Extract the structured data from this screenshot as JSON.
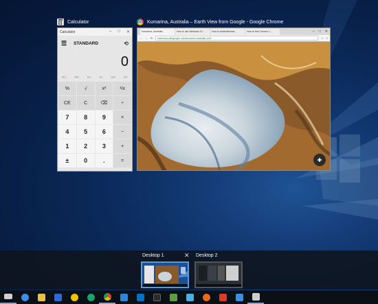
{
  "windows": [
    {
      "title": "Calculator"
    },
    {
      "title": "Kumarina, Australia – Earth View from Google - Google Chrome"
    }
  ],
  "calculator": {
    "titlebar": "Calculator",
    "mode": "STANDARD",
    "display": "0",
    "memory": [
      "MC",
      "MR",
      "M+",
      "M-",
      "MS",
      "M˅"
    ],
    "keys": [
      "%",
      "√",
      "x²",
      "¹/x",
      "CE",
      "C",
      "⌫",
      "÷",
      "7",
      "8",
      "9",
      "×",
      "4",
      "5",
      "6",
      "−",
      "1",
      "2",
      "3",
      "+",
      "±",
      "0",
      ".",
      "="
    ]
  },
  "browser": {
    "tabs": [
      "Kumarina, Australia - ",
      "How to use Windows 10 ...",
      "How to add/edit/creat...",
      "How to find Chrome 1..."
    ],
    "url": "earthview.withgoogle.com/kumarina-australia-1181"
  },
  "task_view": {
    "desktops": [
      {
        "label": "Desktop 1",
        "selected": true
      },
      {
        "label": "Desktop 2",
        "selected": false
      }
    ],
    "close_label": "✕"
  },
  "taskbar": {
    "icons": [
      "task-view-icon",
      "edge-icon",
      "file-explorer-icon",
      "store-icon",
      "weather-icon",
      "groove-icon",
      "chrome-icon",
      "photos-icon",
      "outlook-icon",
      "xbox-icon",
      "notepad-icon",
      "photos-app-icon",
      "firefox-icon",
      "office-icon",
      "mail-icon",
      "calculator-icon"
    ],
    "colors": [
      "#d0d0d0",
      "#3a8ee6",
      "#e8c04a",
      "#2b6ad6",
      "#f0c400",
      "#1aa36a",
      "#4caf50",
      "#2b88d8",
      "#0072c6",
      "#2a2a2a",
      "#5aa040",
      "#4ab0e0",
      "#e86b1a",
      "#d93a2a",
      "#3a8ee6",
      "#cccccc"
    ]
  }
}
